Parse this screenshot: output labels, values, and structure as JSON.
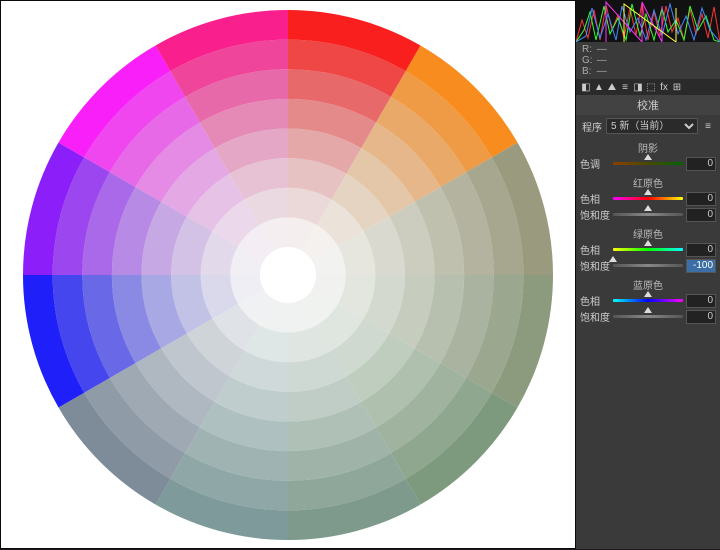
{
  "rgb_readout": {
    "r_label": "R:",
    "g_label": "G:",
    "b_label": "B:",
    "r": "—",
    "g": "—",
    "b": "—"
  },
  "panel": {
    "title": "校准"
  },
  "preset": {
    "label": "程序",
    "value": "5 新（当前）"
  },
  "sections": {
    "shadow": {
      "header": "阴影",
      "tint": {
        "label": "色调",
        "value": "0"
      }
    },
    "red": {
      "header": "红原色",
      "hue": {
        "label": "色相",
        "value": "0"
      },
      "sat": {
        "label": "饱和度",
        "value": "0"
      }
    },
    "green": {
      "header": "绿原色",
      "hue": {
        "label": "色相",
        "value": "0"
      },
      "sat": {
        "label": "饱和度",
        "value": "-100"
      }
    },
    "blue": {
      "header": "蓝原色",
      "hue": {
        "label": "色相",
        "value": "0"
      },
      "sat": {
        "label": "饱和度",
        "value": "0"
      }
    }
  },
  "tab_icons": [
    "crop",
    "eye",
    "tone",
    "hsl",
    "split",
    "fx",
    "curve",
    "cal"
  ],
  "chart_data": {
    "type": "color-wheel",
    "segments": 12,
    "rings": 8,
    "hue_start_deg": 0,
    "desaturated_hues": [
      "green",
      "yellow-green",
      "yellow",
      "cyan",
      "blue-cyan"
    ],
    "note": "Color wheel preview showing effect of green saturation at -100; greens/yellows/cyans appear washed out"
  }
}
